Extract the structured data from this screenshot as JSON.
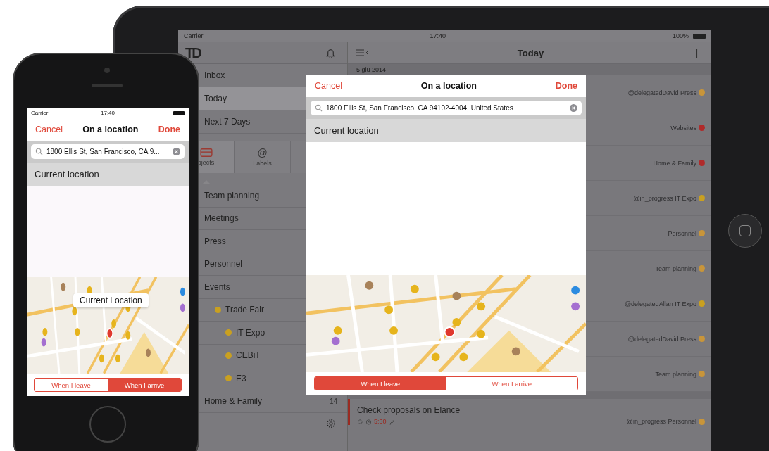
{
  "ipad": {
    "status_bar": {
      "carrier": "Carrier",
      "time": "17:40",
      "battery": "100%"
    },
    "sidebar": {
      "logo": "TD",
      "nav": [
        {
          "label": "Inbox",
          "selected": false
        },
        {
          "label": "Today",
          "selected": true
        },
        {
          "label": "Next 7 Days",
          "selected": false
        }
      ],
      "tabs": [
        {
          "kind": "projects",
          "label": "ojects",
          "selected": true
        },
        {
          "kind": "labels",
          "icon": "@",
          "label": "Labels",
          "selected": false
        }
      ],
      "projects": [
        {
          "label": "Team planning"
        },
        {
          "label": "Meetings"
        },
        {
          "label": "Press"
        },
        {
          "label": "Personnel"
        },
        {
          "label": "Events",
          "children": [
            {
              "label": "Trade Fair",
              "color": "#c9a020",
              "children": [
                {
                  "label": "IT Expo",
                  "color": "#c9a020"
                },
                {
                  "label": "CEBiT",
                  "color": "#c9a020"
                },
                {
                  "label": "E3",
                  "color": "#c9a020"
                }
              ]
            }
          ]
        },
        {
          "label": "Home & Family",
          "count": "14"
        }
      ]
    },
    "main": {
      "title": "Today",
      "date": "5 giu 2014",
      "tasks": [
        {
          "label": "@delegatedDavid Press",
          "color": "#c8953a"
        },
        {
          "label": "Websites",
          "color": "#b02a2a"
        },
        {
          "label": "Home & Family",
          "color": "#b02a2a"
        },
        {
          "label": "@in_progress IT Expo",
          "color": "#c9a020"
        },
        {
          "label": "Personnel",
          "color": "#c8953a"
        },
        {
          "label": "Team planning",
          "color": "#c8953a"
        },
        {
          "label": "@delegatedAllan IT Expo",
          "color": "#c9a020"
        },
        {
          "label": "@delegatedDavid Press",
          "color": "#c8953a"
        },
        {
          "label": "Team planning",
          "color": "#c8953a"
        }
      ],
      "next_task": {
        "title": "Check proposals on Elance",
        "time": "5:30",
        "label": "@in_progress Personnel",
        "color": "#c8953a"
      }
    },
    "dialog": {
      "cancel": "Cancel",
      "title": "On a location",
      "done": "Done",
      "search_value": "1800 Ellis St, San Francisco, CA  94102-4004, United States",
      "current_location": {
        "label": "Current location",
        "selected": true
      },
      "segments": [
        {
          "label": "When I leave",
          "selected": true
        },
        {
          "label": "When I arrive",
          "selected": false
        }
      ]
    }
  },
  "iphone": {
    "status_bar": {
      "carrier": "Carrier",
      "time": "17:40"
    },
    "dialog": {
      "cancel": "Cancel",
      "title": "On a location",
      "done": "Done",
      "search_value": "1800 Ellis St, San Francisco, CA  9...",
      "current_location": {
        "label": "Current location",
        "selected": true
      },
      "map_callout": "Current Location",
      "segments": [
        {
          "label": "When I leave",
          "selected": false
        },
        {
          "label": "When I arrive",
          "selected": true
        }
      ]
    }
  }
}
